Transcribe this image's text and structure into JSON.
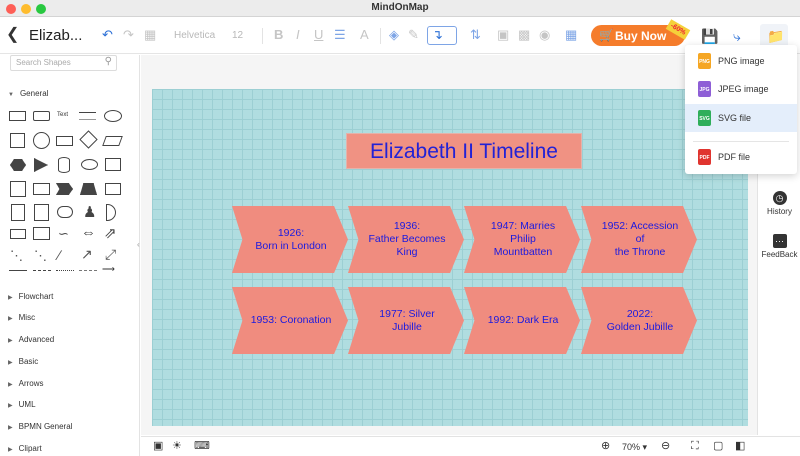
{
  "app": {
    "title": "MindOnMap"
  },
  "toolbar": {
    "doc_title": "Elizab...",
    "font_name": "Helvetica",
    "font_size": "12",
    "buy_label": "Buy Now",
    "discount_badge": "-60%"
  },
  "sidebar": {
    "search_placeholder": "Search Shapes",
    "open_category": "General",
    "text_shape_label": "Text",
    "categories": [
      "Flowchart",
      "Misc",
      "Advanced",
      "Basic",
      "Arrows",
      "UML",
      "BPMN General",
      "Clipart"
    ]
  },
  "canvas": {
    "title": "Elizabeth II Timeline",
    "events_row1": [
      "1926:\nBorn in London",
      "1936:\nFather Becomes\nKing",
      "1947: Marries\nPhilip Mountbatten",
      "1952: Accession of\nthe Throne"
    ],
    "events_row2": [
      "1953: Coronation",
      "1977: Silver Jubille",
      "1992: Dark Era",
      "2022:\nGolden Jubille"
    ]
  },
  "export_menu": {
    "items": [
      {
        "label": "PNG image",
        "icon": "png-file-icon",
        "color": "#f5a623",
        "tag": "PNG"
      },
      {
        "label": "JPEG image",
        "icon": "jpeg-file-icon",
        "color": "#8e5fd6",
        "tag": "JPG"
      },
      {
        "label": "SVG file",
        "icon": "svg-file-icon",
        "color": "#2fae5a",
        "tag": "SVG"
      },
      {
        "label": "PDF file",
        "icon": "pdf-file-icon",
        "color": "#e0342f",
        "tag": "PDF"
      }
    ],
    "selected": "SVG file"
  },
  "right_rail": {
    "history": "History",
    "feedback": "FeedBack"
  },
  "statusbar": {
    "zoom": "70%"
  },
  "colors": {
    "accent": "#2b6fd6",
    "buy": "#f57c2b",
    "node_fill": "#f08c7f",
    "node_text": "#1a1ae0",
    "canvas_bg": "#b0dde0"
  }
}
